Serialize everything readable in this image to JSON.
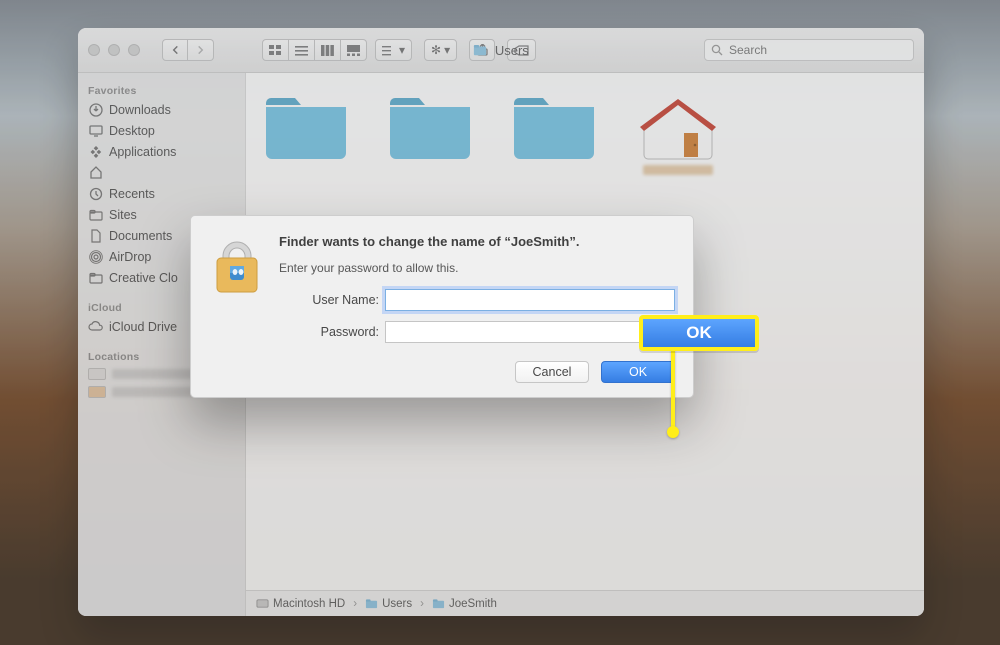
{
  "finder": {
    "title": "Users",
    "search_placeholder": "Search"
  },
  "sidebar": {
    "sections": {
      "favorites": "Favorites",
      "icloud": "iCloud",
      "locations": "Locations"
    },
    "favorites": [
      {
        "label": "Downloads"
      },
      {
        "label": "Desktop"
      },
      {
        "label": "Applications"
      },
      {
        "label": ""
      },
      {
        "label": "Recents"
      },
      {
        "label": "Sites"
      },
      {
        "label": "Documents"
      },
      {
        "label": "AirDrop"
      },
      {
        "label": "Creative Clo"
      }
    ],
    "icloud": [
      {
        "label": "iCloud Drive"
      }
    ]
  },
  "pathbar": {
    "crumbs": [
      {
        "label": "Macintosh HD"
      },
      {
        "label": "Users"
      },
      {
        "label": "JoeSmith"
      }
    ]
  },
  "dialog": {
    "heading": "Finder wants to change the name of “JoeSmith”.",
    "subheading": "Enter your password to allow this.",
    "username_label": "User Name:",
    "password_label": "Password:",
    "username_value": "",
    "password_value": "",
    "cancel": "Cancel",
    "ok": "OK"
  },
  "callout": {
    "label": "OK"
  }
}
